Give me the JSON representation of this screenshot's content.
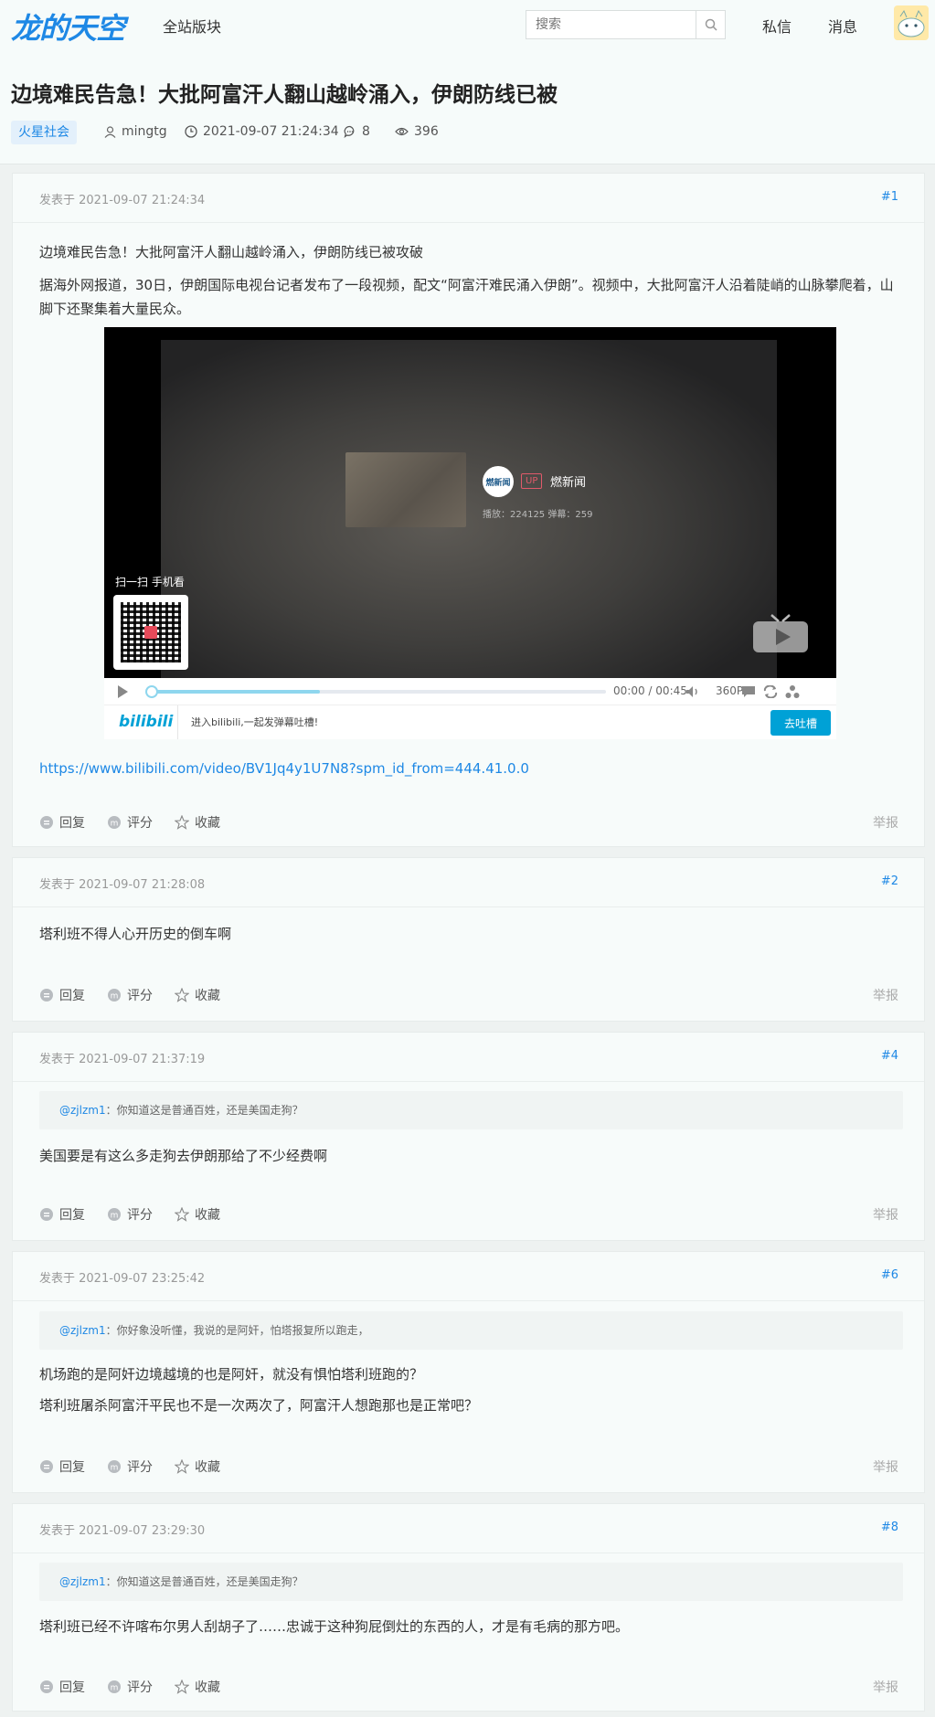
{
  "header": {
    "logo": "龙的天空",
    "nav_boards": "全站版块",
    "search_placeholder": "搜索",
    "nav_messages": "私信",
    "nav_notifications": "消息"
  },
  "thread": {
    "title": "边境难民告急！大批阿富汗人翻山越岭涌入，伊朗防线已被",
    "forum": "火星社会",
    "author": "mingtg",
    "datetime": "2021-09-07 21:24:34",
    "replies": "8",
    "views": "396"
  },
  "labels": {
    "reply": "回复",
    "rate": "评分",
    "favorite": "收藏",
    "report": "举报"
  },
  "posts": [
    {
      "date": "发表于 2021-09-07 21:24:34",
      "num": "#1",
      "line1": "边境难民告急！大批阿富汗人翻山越岭涌入，伊朗防线已被攻破",
      "line2": "据海外网报道，30日，伊朗国际电视台记者发布了一段视频，配文“阿富汗难民涌入伊朗”。视频中，大批阿富汗人沿着陡峭的山脉攀爬着，山脚下还聚集着大量民众。",
      "link": "https://www.bilibili.com/video/BV1Jq4y1U7N8?spm_id_from=444.41.0.0"
    },
    {
      "date": "发表于 2021-09-07 21:28:08",
      "num": "#2",
      "line1": "塔利班不得人心开历史的倒车啊"
    },
    {
      "date": "发表于 2021-09-07 21:37:19",
      "num": "#4",
      "quote_user": "@zjlzm1",
      "quote_text": "：你知道这是普通百姓，还是美国走狗？",
      "line1": "美国要是有这么多走狗去伊朗那给了不少经费啊"
    },
    {
      "date": "发表于 2021-09-07 23:25:42",
      "num": "#6",
      "quote_user": "@zjlzm1",
      "quote_text": "：你好象没听懂，我说的是阿奸，怕塔报复所以跑走，",
      "line1": "机场跑的是阿奸边境越境的也是阿奸，就没有惧怕塔利班跑的？",
      "line2": "塔利班屠杀阿富汗平民也不是一次两次了，阿富汗人想跑那也是正常吧？"
    },
    {
      "date": "发表于 2021-09-07 23:29:30",
      "num": "#8",
      "quote_user": "@zjlzm1",
      "quote_text": "：你知道这是普通百姓，还是美国走狗？",
      "line1": "塔利班已经不许喀布尔男人刮胡子了……忠诚于这种狗屁倒灶的东西的人，才是有毛病的那方吧。"
    }
  ],
  "video": {
    "uploader_badge": "燃新闻",
    "up_tag": "UP",
    "uploader": "燃新闻",
    "stats": "播放：224125     弹幕：259",
    "scan_label": "扫一扫 手机看",
    "time_current": "00:00",
    "time_sep": "/",
    "time_total": "00:45",
    "quality": "360P",
    "bili_logo": "bilibili",
    "danmaku_tip": "进入bilibili,一起发弹幕吐槽!",
    "danmaku_button": "去吐槽",
    "buffered_fraction": 0.37,
    "played_fraction": 0
  },
  "colors": {
    "accent": "#1e88e5",
    "bilibili": "#00a1d6",
    "page_bg": "#eef2f1"
  }
}
